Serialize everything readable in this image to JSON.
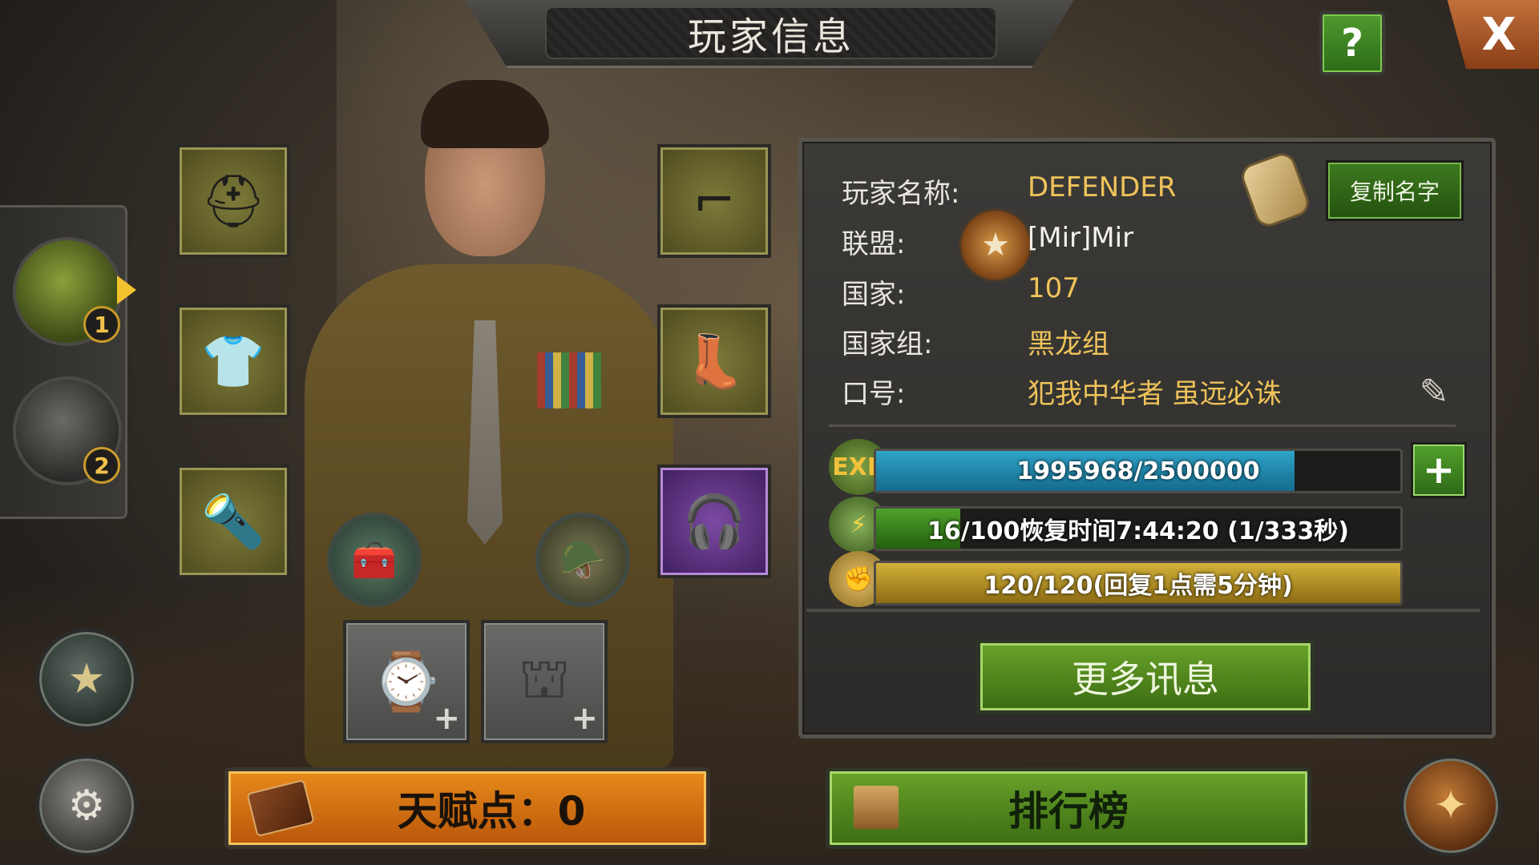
{
  "header": {
    "title": "玩家信息"
  },
  "buttons": {
    "help": "?",
    "close": "X",
    "copy_name": "复制名字",
    "more_info": "更多讯息",
    "talent": "天赋点：0",
    "ranking": "排行榜",
    "exp_add": "+"
  },
  "loadouts": [
    {
      "number": "1"
    },
    {
      "number": "2"
    }
  ],
  "player": {
    "name_label": "玩家名称:",
    "name": "DEFENDER",
    "alliance_label": "联盟:",
    "alliance": "[Mir]Mir",
    "country_label": "国家:",
    "country": "107",
    "group_label": "国家组:",
    "group": "黑龙组",
    "slogan_label": "口号:",
    "slogan": "犯我中华者 虽远必诛"
  },
  "bars": {
    "exp": {
      "icon_text": "EXP",
      "text": "1995968/2500000",
      "fraction": 0.798
    },
    "energy": {
      "text": "16/100恢复时间7:44:20 (1/333秒)",
      "fraction": 0.16
    },
    "stamina": {
      "text": "120/120(回复1点需5分钟)",
      "fraction": 1.0
    }
  },
  "icons": {
    "help": "question-icon",
    "close": "close-icon",
    "rank": "rank-emblem-icon",
    "settings": "gear-icon",
    "eagle": "eagle-emblem-icon",
    "edit": "edit-icon"
  },
  "colors": {
    "exp": "#2fa3c8",
    "energy": "#4ea12b",
    "stamina": "#d3b13a",
    "accent_gold": "#f0c35a"
  }
}
